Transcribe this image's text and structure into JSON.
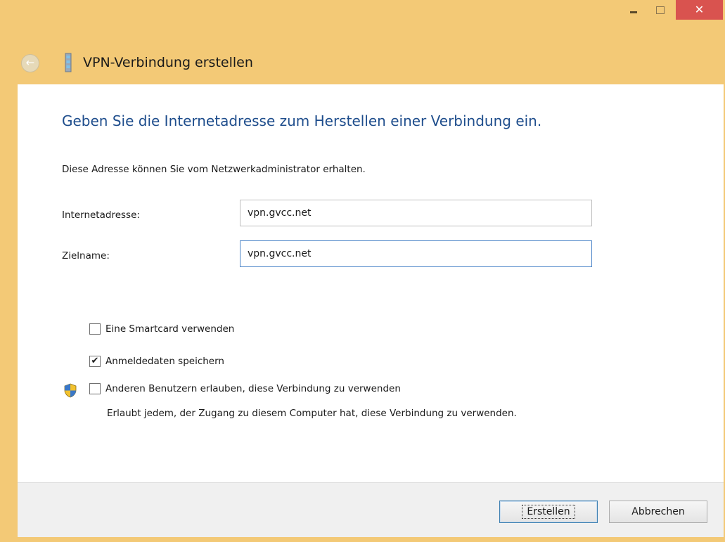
{
  "window": {
    "title": "VPN-Verbindung erstellen",
    "controls": {
      "minimize": "–",
      "maximize": "□",
      "close": "✕"
    }
  },
  "content": {
    "heading": "Geben Sie die Internetadresse zum Herstellen einer Verbindung ein.",
    "info": "Diese Adresse können Sie vom Netzwerkadministrator erhalten.",
    "fields": {
      "internet_address": {
        "label": "Internetadresse:",
        "value": "vpn.gvcc.net"
      },
      "destination_name": {
        "label": "Zielname:",
        "value": "vpn.gvcc.net"
      }
    },
    "options": {
      "smartcard": {
        "label": "Eine Smartcard verwenden",
        "checked": false
      },
      "save_credentials": {
        "label": "Anmeldedaten speichern",
        "checked": true,
        "mark": "✔"
      },
      "allow_others": {
        "label": "Anderen Benutzern erlauben, diese Verbindung zu verwenden",
        "checked": false,
        "description": "Erlaubt jedem, der Zugang zu diesem Computer hat, diese Verbindung zu verwenden."
      }
    }
  },
  "footer": {
    "create_label": "Erstellen",
    "cancel_label": "Abbrechen"
  },
  "icons": {
    "back": "back-arrow-icon",
    "network": "network-connection-icon",
    "shield": "uac-shield-icon"
  },
  "colors": {
    "title_bar": "#f3c976",
    "heading": "#1e4d8c",
    "close_button": "#d9534f",
    "focus_border": "#4f87c9"
  }
}
